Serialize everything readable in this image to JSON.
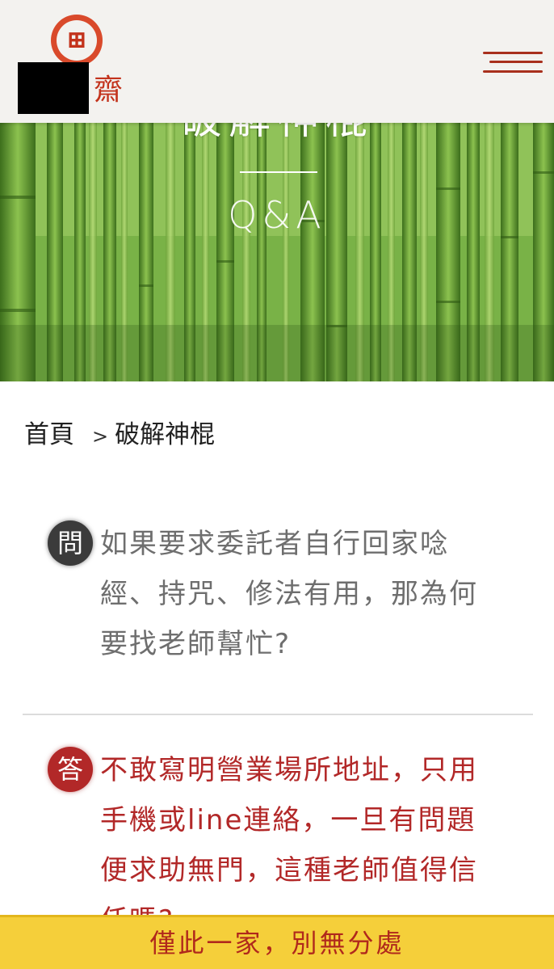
{
  "header": {
    "logo_text": "齋",
    "menu_icon": "hamburger-icon"
  },
  "hero": {
    "title": "破解神棍",
    "subtitle": "Q&A"
  },
  "breadcrumb": {
    "home": "首頁",
    "separator": ">",
    "current": "破解神棍"
  },
  "qa": {
    "question_badge": "問",
    "question": "如果要求委託者自行回家唸經、持咒、修法有用，那為何要找老師幫忙?",
    "answer_badge": "答",
    "answer": "不敢寫明營業場所地址，只用手機或line連絡，一旦有問題便求助無門，這種老師值得信任嗎?"
  },
  "bottom_bar": {
    "label": "僅此一家，別無分處"
  },
  "colors": {
    "accent_red": "#b22828",
    "bar_yellow": "#f5cf3a",
    "question_gray": "#6e6e6e"
  }
}
